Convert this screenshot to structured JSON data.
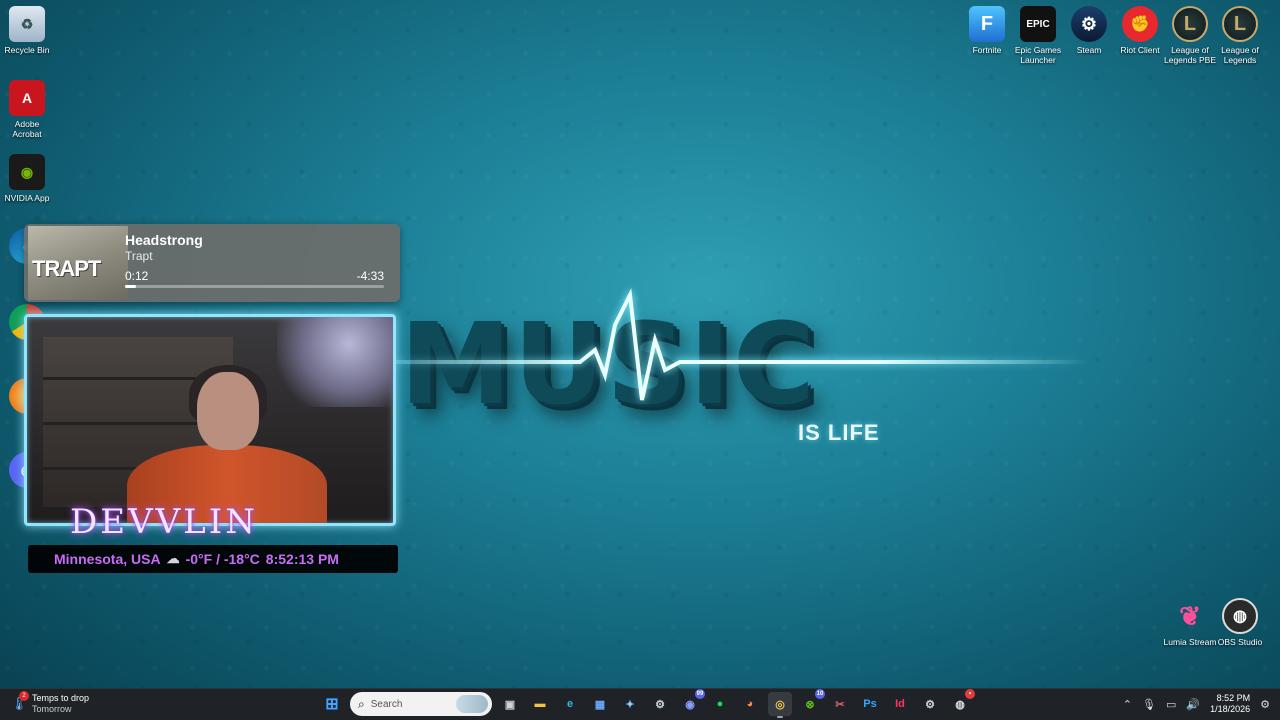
{
  "wallpaper": {
    "headline": "MUSIC",
    "subline": "IS LIFE"
  },
  "desktop_icons_left": [
    {
      "label": "Recycle Bin",
      "icon": "recycle-bin-icon"
    },
    {
      "label": "Adobe Acrobat",
      "icon": "adobe-acrobat-icon"
    },
    {
      "label": "NVIDIA App",
      "icon": "nvidia-icon"
    },
    {
      "label": "Microsoft Edge",
      "icon": "edge-icon"
    },
    {
      "label": "Google Chrome",
      "icon": "chrome-icon"
    },
    {
      "label": "Firefox",
      "icon": "firefox-icon"
    },
    {
      "label": "Discord",
      "icon": "discord-icon"
    }
  ],
  "desktop_icons_right": [
    {
      "label": "Fortnite",
      "icon": "fortnite-icon",
      "glyph": "F"
    },
    {
      "label": "Epic Games Launcher",
      "icon": "epic-games-icon",
      "glyph": "EPIC"
    },
    {
      "label": "Steam",
      "icon": "steam-icon",
      "glyph": "⚙"
    },
    {
      "label": "Riot Client",
      "icon": "riot-client-icon",
      "glyph": "✊"
    },
    {
      "label": "League of Legends PBE",
      "icon": "league-pbe-icon",
      "glyph": "L"
    },
    {
      "label": "League of Legends",
      "icon": "league-icon",
      "glyph": "L"
    }
  ],
  "desktop_icons_bottom_right": [
    {
      "label": "Lumia Stream",
      "icon": "lumia-stream-icon"
    },
    {
      "label": "OBS Studio",
      "icon": "obs-studio-icon"
    }
  ],
  "media": {
    "album_text": "TRAPT",
    "title": "Headstrong",
    "artist": "Trapt",
    "elapsed": "0:12",
    "remaining": "-4:33",
    "progress": 0.044
  },
  "overlay": {
    "name": "DEVVLIN",
    "location": "Minnesota, USA",
    "temperature": "-0°F / -18°C",
    "time": "8:52:13 PM"
  },
  "taskbar": {
    "weather_title": "Temps to drop",
    "weather_sub": "Tomorrow",
    "weather_badge": "2",
    "search_placeholder": "Search",
    "apps": [
      {
        "name": "start-button",
        "glyph": "⊞",
        "color": "#3ea6ff"
      },
      {
        "name": "task-view",
        "glyph": "▣",
        "color": "#cfd3d8"
      },
      {
        "name": "file-explorer",
        "glyph": "▬",
        "color": "#f4c542"
      },
      {
        "name": "edge",
        "glyph": "e",
        "color": "#2fb6e8"
      },
      {
        "name": "ms-store",
        "glyph": "▦",
        "color": "#6aa9ff"
      },
      {
        "name": "copilot",
        "glyph": "✦",
        "color": "#7fd0ff"
      },
      {
        "name": "steam",
        "glyph": "⚙",
        "color": "#c7d5e0"
      },
      {
        "name": "discord",
        "glyph": "◉",
        "color": "#8c9eff",
        "badge": "99"
      },
      {
        "name": "spotify",
        "glyph": "●",
        "color": "#1ed760"
      },
      {
        "name": "firefox",
        "glyph": "◕",
        "color": "#ff8a3d"
      },
      {
        "name": "chrome",
        "glyph": "◎",
        "color": "#f2c14e",
        "active": true
      },
      {
        "name": "xbox",
        "glyph": "⊗",
        "color": "#5dc21e",
        "badge": "10"
      },
      {
        "name": "snipping-tool",
        "glyph": "✂",
        "color": "#e06060"
      },
      {
        "name": "photoshop",
        "glyph": "Ps",
        "color": "#31a8ff"
      },
      {
        "name": "indesign",
        "glyph": "Id",
        "color": "#ff3366"
      },
      {
        "name": "steam-2",
        "glyph": "⚙",
        "color": "#c7d5e0"
      },
      {
        "name": "obs",
        "glyph": "◍",
        "color": "#dddddd",
        "badge": "•"
      }
    ],
    "time": "8:52 PM",
    "date": "1/18/2026"
  }
}
